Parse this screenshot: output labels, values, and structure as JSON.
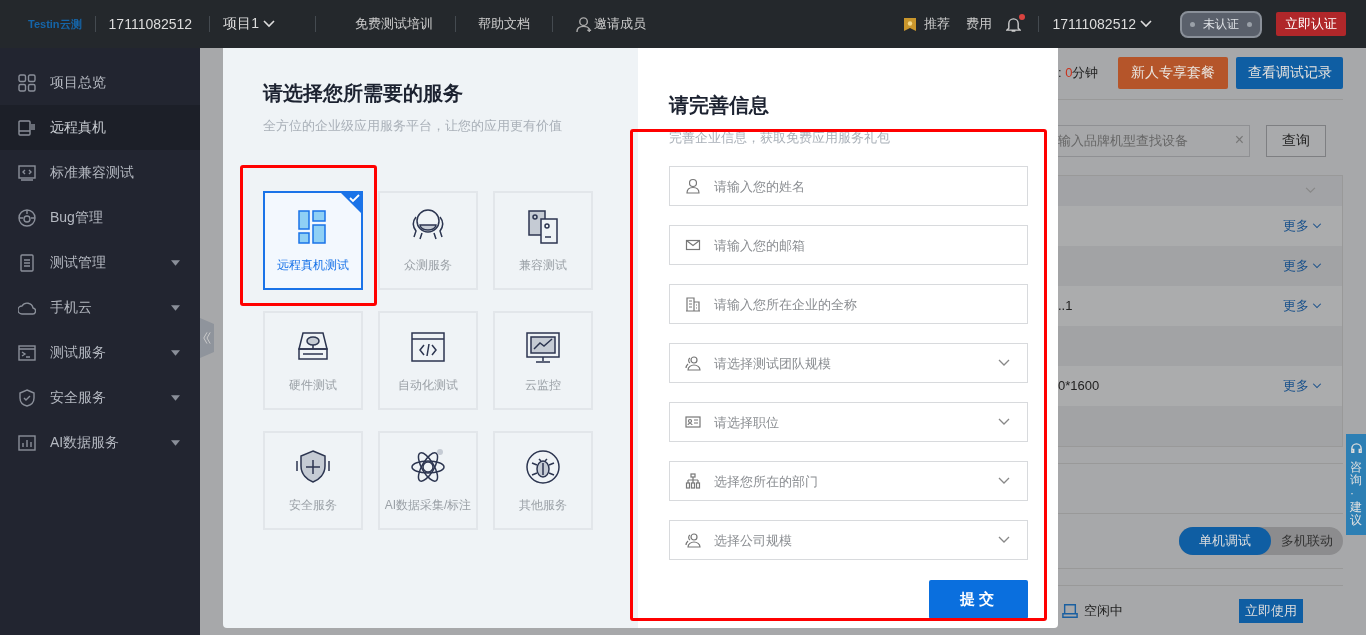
{
  "topbar": {
    "logo": "Testin云测",
    "account": "17111082512",
    "project": "项目1",
    "links": [
      "免费测试培训",
      "帮助文档"
    ],
    "invite": "邀请成员",
    "recommend": "推荐",
    "fees": "费用",
    "unread": true,
    "user": "17111082512",
    "cert_status": "未认证",
    "certify_button": "立即认证"
  },
  "sidebar": {
    "items": [
      {
        "label": "项目总览",
        "selected": false,
        "expandable": false
      },
      {
        "label": "远程真机",
        "selected": true,
        "expandable": false
      },
      {
        "label": "标准兼容测试",
        "selected": false,
        "expandable": false
      },
      {
        "label": "Bug管理",
        "selected": false,
        "expandable": false
      },
      {
        "label": "测试管理",
        "selected": false,
        "expandable": true
      },
      {
        "label": "手机云",
        "selected": false,
        "expandable": true
      },
      {
        "label": "测试服务",
        "selected": false,
        "expandable": true
      },
      {
        "label": "安全服务",
        "selected": false,
        "expandable": true
      },
      {
        "label": "AI数据服务",
        "selected": false,
        "expandable": true
      }
    ]
  },
  "background": {
    "timer": {
      "sep": ":",
      "value": "0",
      "unit": "分钟"
    },
    "buttons": [
      "新人专享套餐",
      "查看调试记录"
    ],
    "search": {
      "placeholder": "输入品牌机型查找设备",
      "clear": "×",
      "button": "查询"
    },
    "rows": [
      {
        "more": "更多"
      },
      {
        "more": "更多"
      },
      {
        "cell": "..1",
        "more": "更多"
      },
      {},
      {
        "cell": "0*1600",
        "more": "更多"
      },
      {}
    ],
    "modes": [
      {
        "label": "单机调试",
        "selected": true
      },
      {
        "label": "多机联动",
        "selected": false
      }
    ],
    "device": {
      "status": "空闲中",
      "button": "立即使用"
    },
    "feedback": "咨询·建议"
  },
  "modal": {
    "services": {
      "title": "请选择您所需要的服务",
      "subtitle": "全方位的企业级应用服务平台，让您的应用更有价值",
      "items": [
        {
          "label": "远程真机测试",
          "selected": true
        },
        {
          "label": "众测服务",
          "selected": false
        },
        {
          "label": "兼容测试",
          "selected": false
        },
        {
          "label": "硬件测试",
          "selected": false
        },
        {
          "label": "自动化测试",
          "selected": false
        },
        {
          "label": "云监控",
          "selected": false
        },
        {
          "label": "安全服务",
          "selected": false
        },
        {
          "label": "AI数据采集/标注",
          "selected": false
        },
        {
          "label": "其他服务",
          "selected": false
        }
      ]
    },
    "form": {
      "title": "请完善信息",
      "subtitle": "完善企业信息，获取免费应用服务礼包",
      "fields": [
        {
          "kind": "input",
          "placeholder": "请输入您的姓名"
        },
        {
          "kind": "input",
          "placeholder": "请输入您的邮箱"
        },
        {
          "kind": "input",
          "placeholder": "请输入您所在企业的全称"
        },
        {
          "kind": "select",
          "placeholder": "请选择测试团队规模"
        },
        {
          "kind": "select",
          "placeholder": "请选择职位"
        },
        {
          "kind": "select",
          "placeholder": "选择您所在的部门"
        },
        {
          "kind": "select",
          "placeholder": "选择公司规模"
        }
      ],
      "submit": "提交"
    }
  }
}
